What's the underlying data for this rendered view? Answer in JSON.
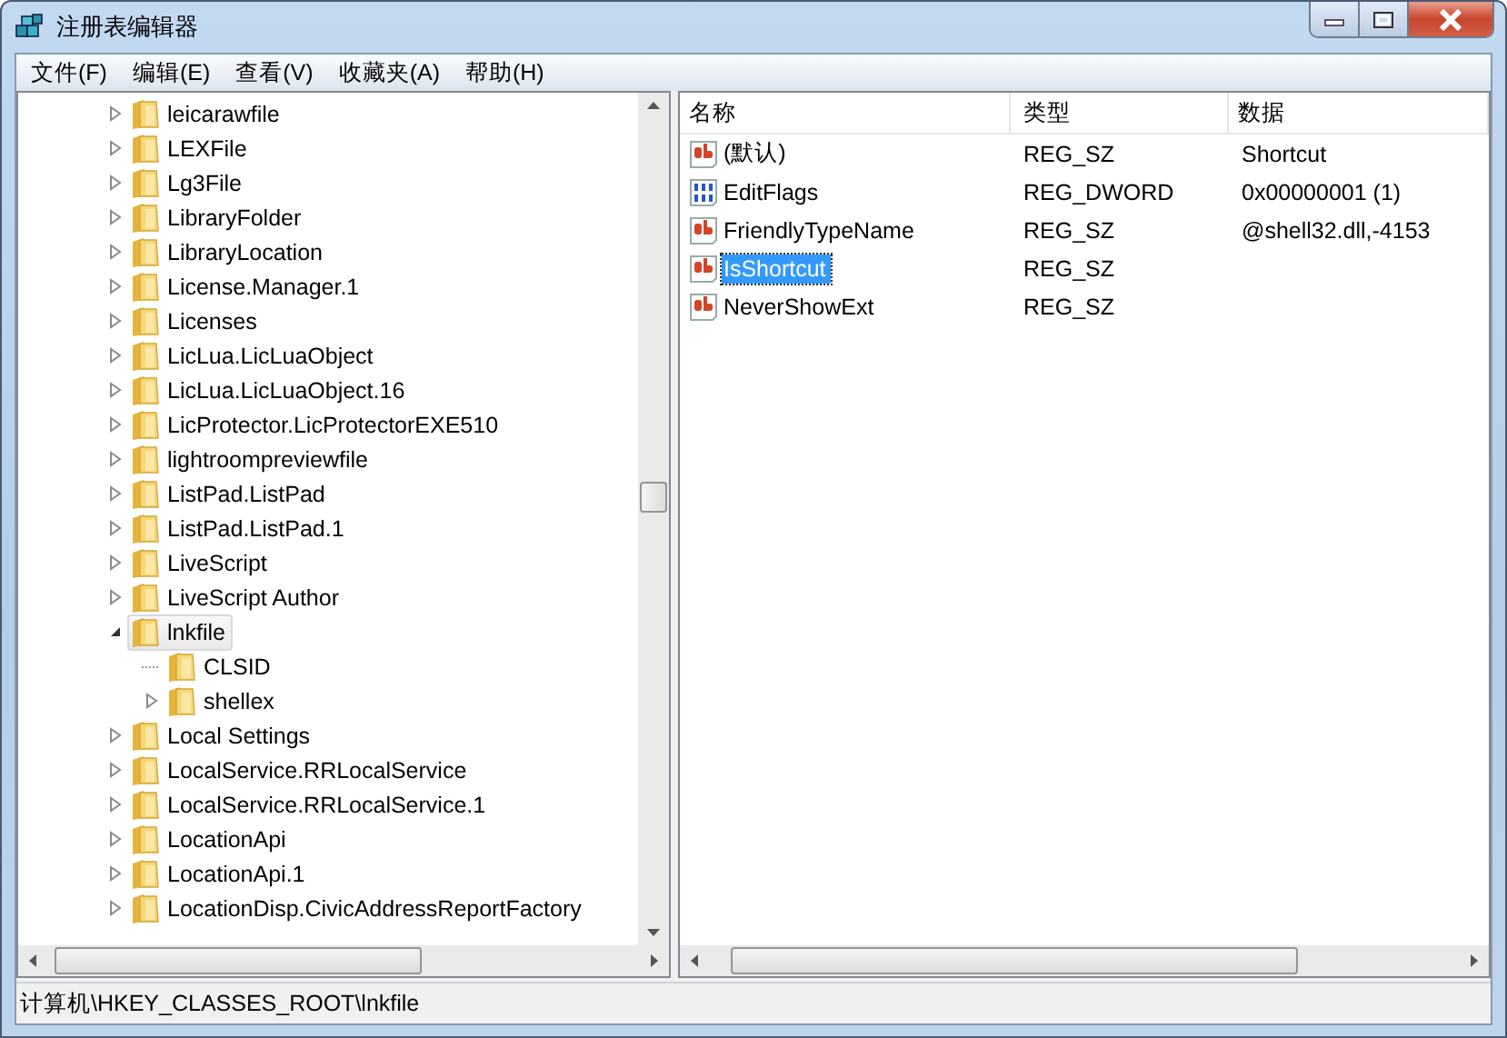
{
  "window": {
    "title": "注册表编辑器"
  },
  "menu": [
    "文件(F)",
    "编辑(E)",
    "查看(V)",
    "收藏夹(A)",
    "帮助(H)"
  ],
  "tree": [
    {
      "name": "leicarawfile",
      "has_children": true,
      "expanded": false,
      "selected": false
    },
    {
      "name": "LEXFile",
      "has_children": true,
      "expanded": false,
      "selected": false
    },
    {
      "name": "Lg3File",
      "has_children": true,
      "expanded": false,
      "selected": false
    },
    {
      "name": "LibraryFolder",
      "has_children": true,
      "expanded": false,
      "selected": false
    },
    {
      "name": "LibraryLocation",
      "has_children": true,
      "expanded": false,
      "selected": false
    },
    {
      "name": "License.Manager.1",
      "has_children": true,
      "expanded": false,
      "selected": false
    },
    {
      "name": "Licenses",
      "has_children": true,
      "expanded": false,
      "selected": false
    },
    {
      "name": "LicLua.LicLuaObject",
      "has_children": true,
      "expanded": false,
      "selected": false
    },
    {
      "name": "LicLua.LicLuaObject.16",
      "has_children": true,
      "expanded": false,
      "selected": false
    },
    {
      "name": "LicProtector.LicProtectorEXE510",
      "has_children": true,
      "expanded": false,
      "selected": false
    },
    {
      "name": "lightroompreviewfile",
      "has_children": true,
      "expanded": false,
      "selected": false
    },
    {
      "name": "ListPad.ListPad",
      "has_children": true,
      "expanded": false,
      "selected": false
    },
    {
      "name": "ListPad.ListPad.1",
      "has_children": true,
      "expanded": false,
      "selected": false
    },
    {
      "name": "LiveScript",
      "has_children": true,
      "expanded": false,
      "selected": false
    },
    {
      "name": "LiveScript Author",
      "has_children": true,
      "expanded": false,
      "selected": false
    },
    {
      "name": "lnkfile",
      "has_children": true,
      "expanded": true,
      "selected": true,
      "children": [
        {
          "name": "CLSID",
          "has_children": false,
          "selected": false
        },
        {
          "name": "shellex",
          "has_children": true,
          "expanded": false,
          "selected": false
        }
      ]
    },
    {
      "name": "Local Settings",
      "has_children": true,
      "expanded": false,
      "selected": false
    },
    {
      "name": "LocalService.RRLocalService",
      "has_children": true,
      "expanded": false,
      "selected": false
    },
    {
      "name": "LocalService.RRLocalService.1",
      "has_children": true,
      "expanded": false,
      "selected": false
    },
    {
      "name": "LocationApi",
      "has_children": true,
      "expanded": false,
      "selected": false
    },
    {
      "name": "LocationApi.1",
      "has_children": true,
      "expanded": false,
      "selected": false
    },
    {
      "name": "LocationDisp.CivicAddressReportFactory",
      "has_children": true,
      "expanded": false,
      "selected": false
    }
  ],
  "values": {
    "columns": [
      "名称",
      "类型",
      "数据"
    ],
    "rows": [
      {
        "kind": "string",
        "name": "(默认)",
        "type": "REG_SZ",
        "data": "Shortcut",
        "selected": false
      },
      {
        "kind": "binary",
        "name": "EditFlags",
        "type": "REG_DWORD",
        "data": "0x00000001 (1)",
        "selected": false
      },
      {
        "kind": "string",
        "name": "FriendlyTypeName",
        "type": "REG_SZ",
        "data": "@shell32.dll,-4153",
        "selected": false
      },
      {
        "kind": "string",
        "name": "IsShortcut",
        "type": "REG_SZ",
        "selected": true
      },
      {
        "kind": "string",
        "name": "NeverShowExt",
        "type": "REG_SZ",
        "selected": false
      }
    ]
  },
  "status_bar": "计算机\\HKEY_CLASSES_ROOT\\lnkfile"
}
